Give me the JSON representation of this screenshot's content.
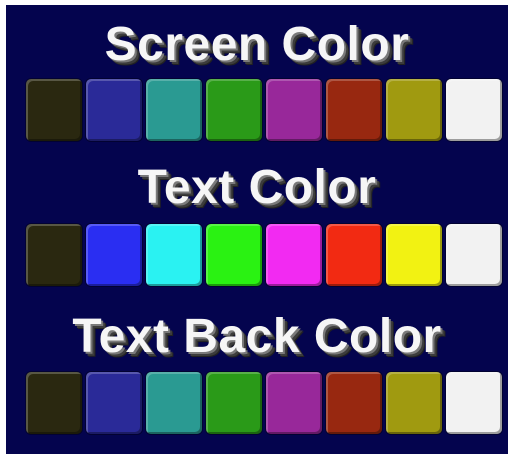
{
  "sections": [
    {
      "title": "Screen Color",
      "swatches": [
        {
          "name": "black",
          "color": "#2a2810"
        },
        {
          "name": "blue",
          "color": "#2a2a98"
        },
        {
          "name": "cyan",
          "color": "#2a9a92"
        },
        {
          "name": "green",
          "color": "#2a9a18"
        },
        {
          "name": "magenta",
          "color": "#98289a"
        },
        {
          "name": "red",
          "color": "#982810"
        },
        {
          "name": "yellow",
          "color": "#a09a10"
        },
        {
          "name": "white",
          "color": "#f2f2f2"
        }
      ]
    },
    {
      "title": "Text Color",
      "swatches": [
        {
          "name": "black",
          "color": "#2a2810"
        },
        {
          "name": "blue",
          "color": "#2a2ef2"
        },
        {
          "name": "cyan",
          "color": "#2af2f2"
        },
        {
          "name": "green",
          "color": "#2af212"
        },
        {
          "name": "magenta",
          "color": "#f22af2"
        },
        {
          "name": "red",
          "color": "#f22a12"
        },
        {
          "name": "yellow",
          "color": "#f2f212"
        },
        {
          "name": "white",
          "color": "#f2f2f2"
        }
      ]
    },
    {
      "title": "Text Back Color",
      "swatches": [
        {
          "name": "black",
          "color": "#2a2810"
        },
        {
          "name": "blue",
          "color": "#2a2a98"
        },
        {
          "name": "cyan",
          "color": "#2a9a92"
        },
        {
          "name": "green",
          "color": "#2a9a18"
        },
        {
          "name": "magenta",
          "color": "#98289a"
        },
        {
          "name": "red",
          "color": "#982810"
        },
        {
          "name": "yellow",
          "color": "#a09a10"
        },
        {
          "name": "white",
          "color": "#f2f2f2"
        }
      ]
    }
  ]
}
